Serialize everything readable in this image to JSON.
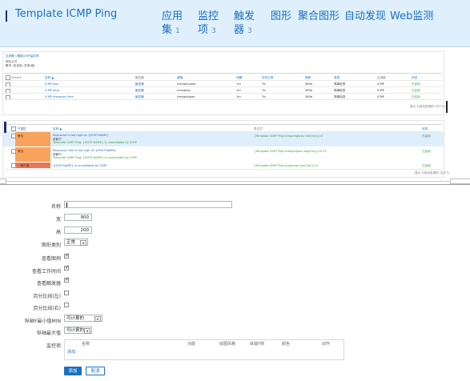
{
  "header": {
    "title": "Template ICMP Ping",
    "nav": [
      {
        "label": "应用\n集",
        "count": "1"
      },
      {
        "label": "监控\n项",
        "count": "3"
      },
      {
        "label": "触发\n器",
        "count": "3"
      },
      {
        "label": "图形",
        "count": ""
      },
      {
        "label": "聚合图形",
        "count": ""
      },
      {
        "label": "自动发现",
        "count": ""
      },
      {
        "label": "Web监测",
        "count": ""
      }
    ]
  },
  "items_panel": {
    "filter_text": "过滤器 ▽模板ICMP监控项",
    "sub1": "模板名称",
    "sub2": "数字 (无正负)   文本(纯)",
    "columns": [
      "Wizard",
      "名称 ▲",
      "触发器",
      "键值",
      "间隔",
      "历史记录",
      "趋势",
      "类型",
      "应用集",
      "状态"
    ],
    "rows": [
      [
        "ICMP loss",
        "触发器",
        "icmppingloss",
        "1m",
        "7d",
        "365d",
        "简单检查",
        "ICMP",
        "已启用"
      ],
      [
        "ICMP ping",
        "触发器",
        "icmpping",
        "1m",
        "7d",
        "365d",
        "简单检查",
        "ICMP",
        "已启用"
      ],
      [
        "ICMP response time",
        "触发器",
        "icmppingsec",
        "1m",
        "7d",
        "365d",
        "简单检查",
        "ICMP",
        "已启用"
      ]
    ],
    "footer": "显示 已自动发现的 (共3个)"
  },
  "triggers_panel": {
    "columns": [
      "严重性",
      "名称 ▲",
      "表达式",
      "状态"
    ],
    "rows": [
      {
        "severity": "警告",
        "name": "Response is too high on {HOST.NAME}",
        "dep": "依赖于:",
        "dep2": "Template ICMP Ping: {HOST.NAME} is unavailable by ICMP",
        "expr": "{Template ICMP Ping:icmppingloss.min(5m)}>0",
        "status": "已启用",
        "color": "#f7a35c"
      },
      {
        "severity": "警告",
        "name": "Response time is too high on {HOST.NAME}",
        "dep": "依赖于:",
        "dep2": "Template ICMP Ping: {HOST.NAME} is unavailable by ICMP",
        "expr": "{Template ICMP Ping:icmppingsec.avg(5m)}>0.15",
        "status": "已启用",
        "color": "#f7a35c"
      },
      {
        "severity": "一般严重",
        "name": "{HOST.NAME} is unavailable by ICMP",
        "dep": "",
        "dep2": "",
        "expr": "{Template ICMP Ping:icmpping.max(3m)}=0",
        "status": "已启用",
        "color": "#e97659"
      }
    ],
    "footer": "显示 已自动发现的 (共3个)"
  },
  "form": {
    "name_label": "名称",
    "name_value": "",
    "width_label": "宽",
    "width_value": "900",
    "height_label": "高",
    "height_value": "200",
    "graphtype_label": "图形类别",
    "graphtype_value": "正常",
    "legend_label": "查看图例",
    "worktime_label": "查看工作时间",
    "triggers_label": "查看触发器",
    "pctleft_label": "百分比线(左)",
    "pctright_label": "百分比线(右)",
    "ymin_label": "纵轴Y最小值MIN",
    "ymin_value": "可计算的",
    "ymax_label": "纵轴最大值",
    "ymax_value": "可计算的",
    "items_label": "监控项",
    "items_columns": [
      "名称",
      "功能",
      "绘图风格",
      "纵轴Y侧",
      "颜色",
      "动作"
    ],
    "items_add": "添加",
    "add_button": "添加",
    "cancel_button": "取消"
  }
}
